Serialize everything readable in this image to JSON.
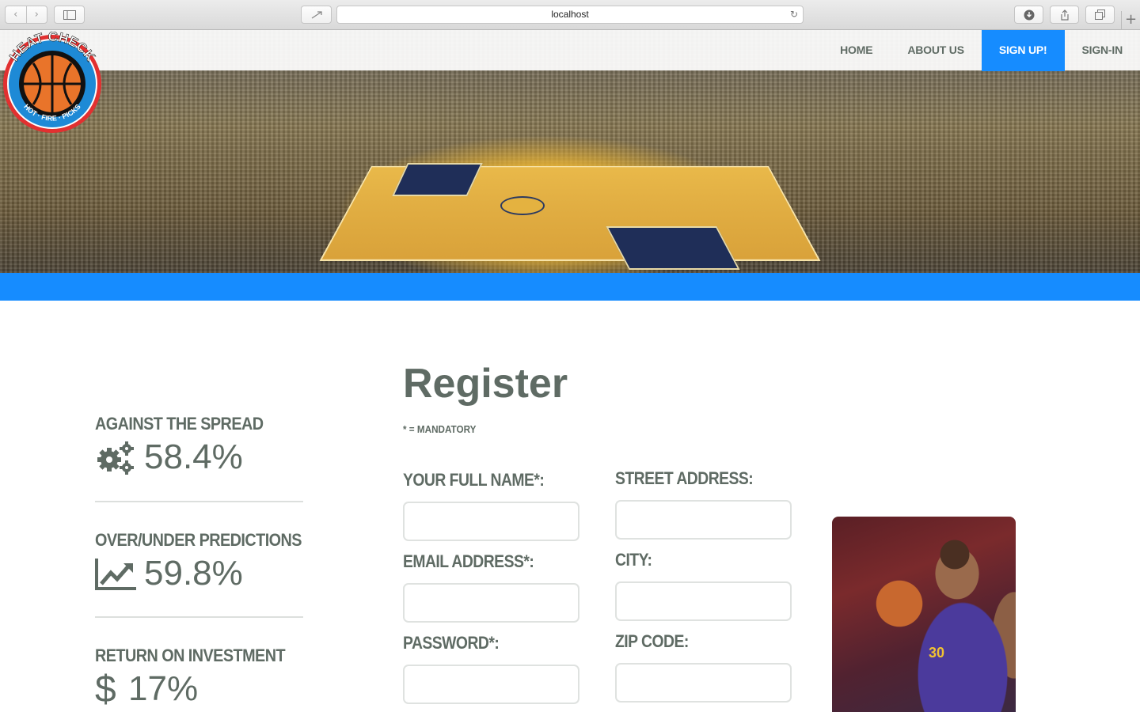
{
  "browser": {
    "url": "localhost",
    "back_icon": "chevron-left-icon",
    "forward_icon": "chevron-right-icon",
    "sidebar_icon": "sidebar-icon",
    "reload_icon": "reload-icon",
    "download_icon": "download-icon",
    "share_icon": "share-icon",
    "tabs_icon": "tabs-icon",
    "new_tab_icon": "plus-icon"
  },
  "site": {
    "brand_color": "#168cff",
    "text_color": "#5f6b64",
    "logo": {
      "top_text": "HEAT CHECK",
      "bottom_text": "HOT · FIRE · PICKS"
    },
    "nav": [
      {
        "label": "HOME",
        "active": false
      },
      {
        "label": "ABOUT US",
        "active": false
      },
      {
        "label": "SIGN UP!",
        "active": true
      },
      {
        "label": "SIGN-IN",
        "active": false
      }
    ]
  },
  "stats": [
    {
      "label": "AGAINST THE SPREAD",
      "value": "58.4%",
      "icon": "gears-icon"
    },
    {
      "label": "OVER/UNDER PREDICTIONS",
      "value": "59.8%",
      "icon": "trend-chart-icon"
    },
    {
      "label": "RETURN ON INVESTMENT",
      "value": "17%",
      "icon": "dollar-icon"
    }
  ],
  "register": {
    "title": "Register",
    "mandatory_note": "* = MANDATORY",
    "fields_left": [
      {
        "label": "YOUR FULL NAME*:",
        "value": "",
        "placeholder": ""
      },
      {
        "label": "EMAIL ADDRESS*:",
        "value": "",
        "placeholder": ""
      },
      {
        "label": "PASSWORD*:",
        "value": "",
        "placeholder": ""
      }
    ],
    "fields_right": [
      {
        "label": "STREET ADDRESS:",
        "value": "",
        "placeholder": ""
      },
      {
        "label": "CITY:",
        "value": "",
        "placeholder": ""
      },
      {
        "label": "ZIP CODE:",
        "value": "",
        "placeholder": ""
      }
    ]
  },
  "photo": {
    "jersey_number": "30"
  }
}
